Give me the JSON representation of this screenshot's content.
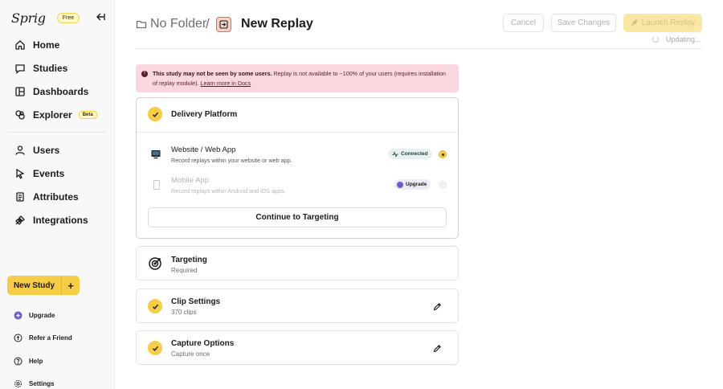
{
  "sidebar": {
    "logo": "Sprig",
    "plan_badge": "Free",
    "nav_primary": [
      {
        "label": "Home",
        "icon": "home-icon"
      },
      {
        "label": "Studies",
        "icon": "chat-icon"
      },
      {
        "label": "Dashboards",
        "icon": "dashboard-icon"
      },
      {
        "label": "Explorer",
        "icon": "explorer-icon",
        "badge": "Beta"
      }
    ],
    "nav_secondary": [
      {
        "label": "Users",
        "icon": "user-icon"
      },
      {
        "label": "Events",
        "icon": "events-icon"
      },
      {
        "label": "Attributes",
        "icon": "attributes-icon"
      },
      {
        "label": "Integrations",
        "icon": "integrations-icon"
      }
    ],
    "new_study_label": "New Study",
    "bottom_links": [
      {
        "label": "Upgrade",
        "icon": "upgrade-icon"
      },
      {
        "label": "Refer a Friend",
        "icon": "refer-icon"
      },
      {
        "label": "Help",
        "icon": "help-icon"
      },
      {
        "label": "Settings",
        "icon": "gear-icon"
      }
    ]
  },
  "header": {
    "folder_label": "No Folder",
    "separator": "/",
    "title": "New Replay",
    "cancel_label": "Cancel",
    "save_label": "Save Changes",
    "launch_label": "Launch Replay",
    "status_text": "Updating..."
  },
  "alert": {
    "bold_text": "This study may not be seen by some users.",
    "body_text": " Replay is not available to ~100% of your users (requires installation of replay module). ",
    "link_text": "Learn more in Docs"
  },
  "delivery": {
    "title": "Delivery Platform",
    "options": [
      {
        "title": "Website / Web App",
        "subtitle": "Record replays within your website or web app.",
        "badge": "Connected",
        "selected": true
      },
      {
        "title": "Mobile App",
        "subtitle": "Record replays within Android and iOS apps.",
        "badge": "Upgrade",
        "selected": false
      }
    ],
    "continue_label": "Continue to Targeting"
  },
  "sections": [
    {
      "title": "Targeting",
      "subtitle": "Required",
      "complete": false
    },
    {
      "title": "Clip Settings",
      "subtitle": "370 clips",
      "complete": true
    },
    {
      "title": "Capture Options",
      "subtitle": "Capture once",
      "complete": true
    }
  ],
  "colors": {
    "accent": "#f7cc46",
    "alert_bg": "#f8d7de",
    "replay_icon": "#e56b4c"
  }
}
